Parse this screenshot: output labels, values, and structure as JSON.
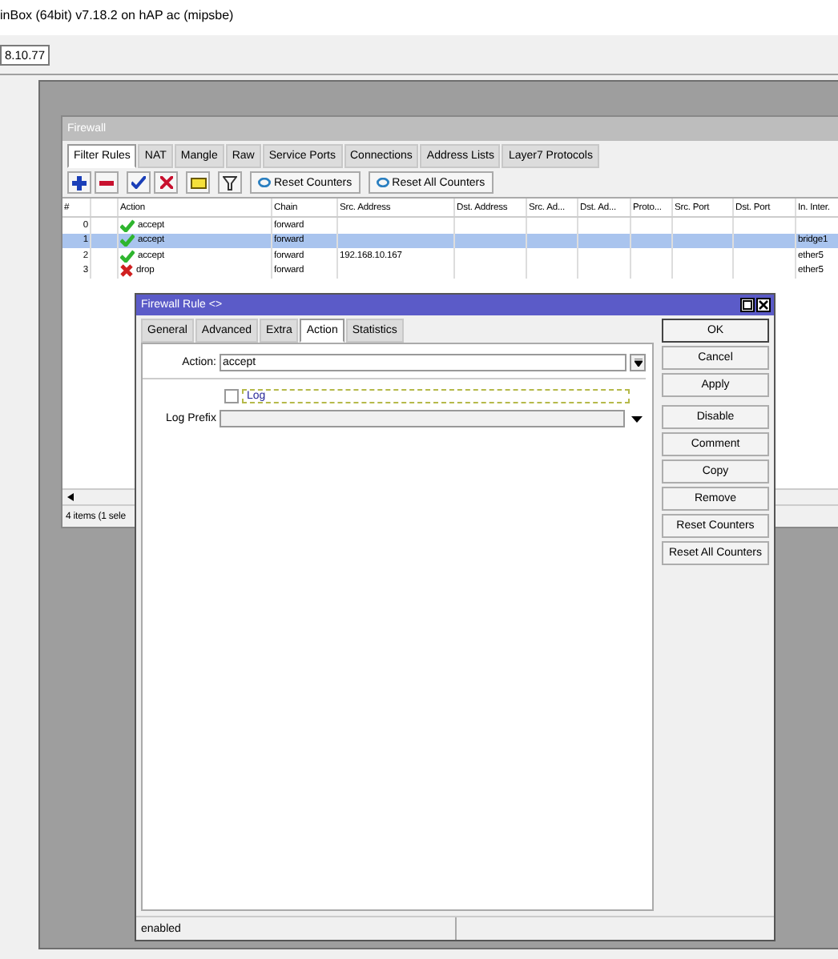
{
  "app_title": "inBox (64bit) v7.18.2 on hAP ac (mipsbe)",
  "address_field": "8.10.77",
  "firewall": {
    "title": "Firewall",
    "tabs": [
      {
        "label": "Filter Rules",
        "selected": true
      },
      {
        "label": "NAT",
        "selected": false
      },
      {
        "label": "Mangle",
        "selected": false
      },
      {
        "label": "Raw",
        "selected": false
      },
      {
        "label": "Service Ports",
        "selected": false
      },
      {
        "label": "Connections",
        "selected": false
      },
      {
        "label": "Address Lists",
        "selected": false
      },
      {
        "label": "Layer7 Protocols",
        "selected": false
      }
    ],
    "toolbar_buttons": [
      "Reset Counters",
      "Reset All Counters"
    ],
    "columns": [
      "#",
      "Action",
      "Chain",
      "Src. Address",
      "Dst. Address",
      "Src. Ad...",
      "Dst. Ad...",
      "Proto...",
      "Src. Port",
      "Dst. Port",
      "In. Inter."
    ],
    "rows": [
      {
        "number": "0",
        "kind": "accept",
        "action": "accept",
        "chain": "forward",
        "selected": false
      },
      {
        "number": "1",
        "kind": "accept",
        "action": "accept",
        "chain": "forward",
        "in_interface": "bridge1",
        "selected": true
      },
      {
        "number": "2",
        "kind": "accept",
        "action": "accept",
        "chain": "forward",
        "src_address": "192.168.10.167",
        "in_interface": "ether5",
        "selected": false
      },
      {
        "number": "3",
        "kind": "drop",
        "action": "drop",
        "chain": "forward",
        "in_interface": "ether5",
        "selected": false
      }
    ],
    "status": "4 items (1 sele"
  },
  "dialog": {
    "title": "Firewall Rule <>",
    "tabs": [
      {
        "label": "General",
        "selected": false
      },
      {
        "label": "Advanced",
        "selected": false
      },
      {
        "label": "Extra",
        "selected": false
      },
      {
        "label": "Action",
        "selected": true
      },
      {
        "label": "Statistics",
        "selected": false
      }
    ],
    "action_label": "Action:",
    "action_value": "accept",
    "log": {
      "label": "Log",
      "checked": false
    },
    "log_prefix_label": "Log Prefix",
    "buttons": [
      "OK",
      "Cancel",
      "Apply",
      "Disable",
      "Comment",
      "Copy",
      "Remove",
      "Reset Counters",
      "Reset All Counters"
    ],
    "status": "enabled"
  }
}
